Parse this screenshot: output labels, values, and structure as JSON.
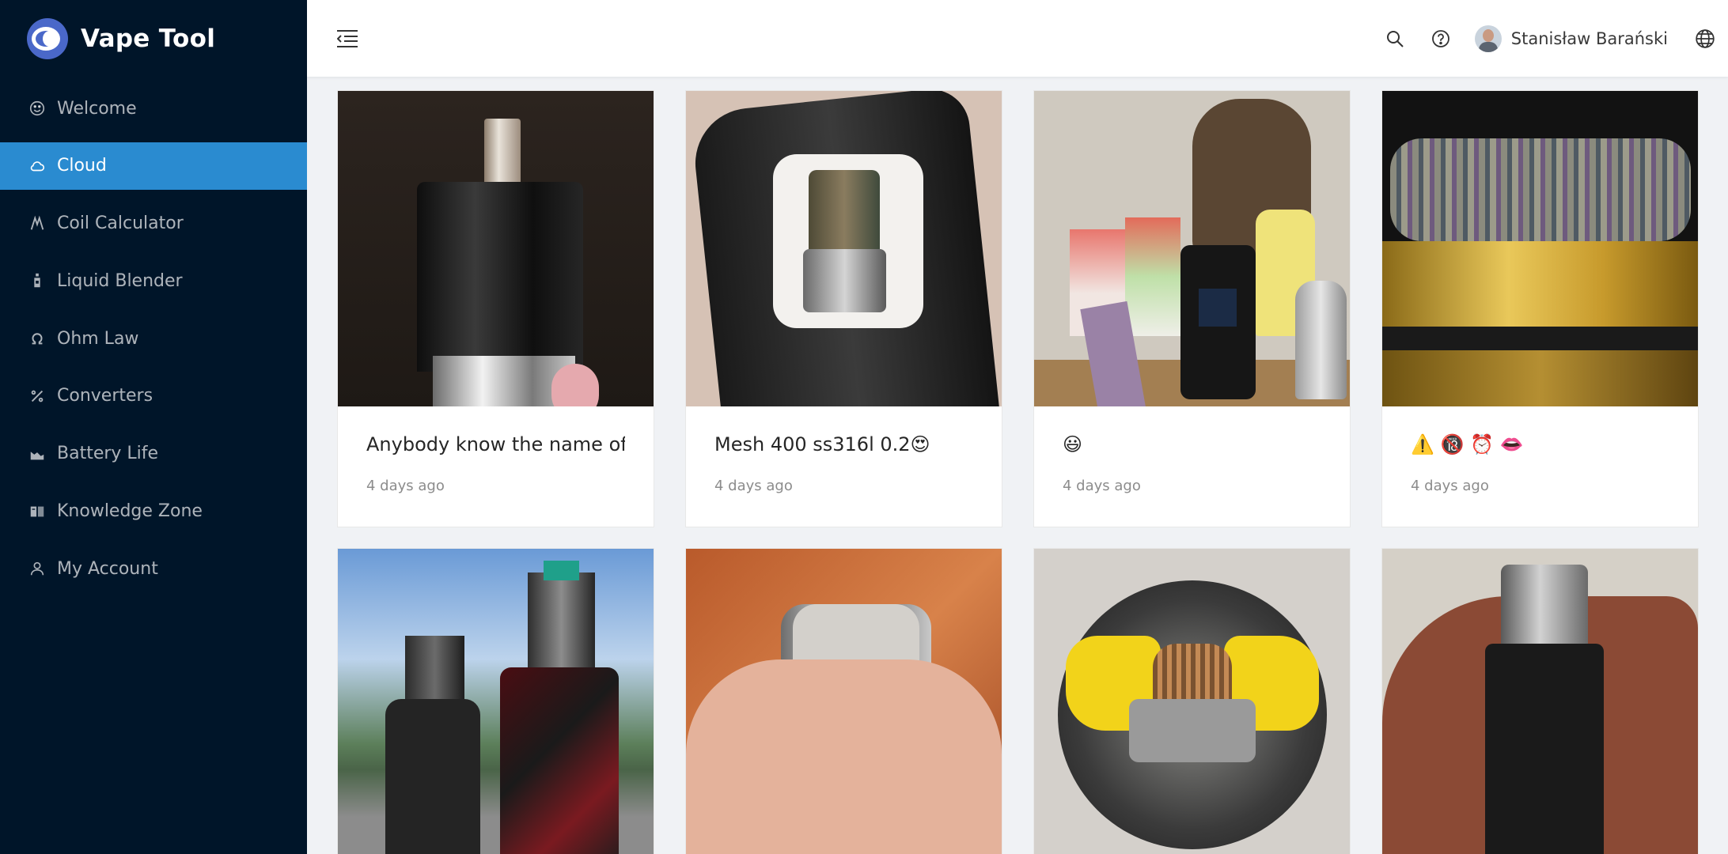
{
  "app": {
    "title": "Vape Tool",
    "accent_color": "#2a8bd0",
    "sidebar_color": "#001529"
  },
  "sidebar": {
    "items": [
      {
        "label": "Welcome",
        "icon": "smile-icon",
        "active": false
      },
      {
        "label": "Cloud",
        "icon": "cloud-icon",
        "active": true
      },
      {
        "label": "Coil Calculator",
        "icon": "coil-icon",
        "active": false
      },
      {
        "label": "Liquid Blender",
        "icon": "bottle-icon",
        "active": false
      },
      {
        "label": "Ohm Law",
        "icon": "omega-icon",
        "active": false
      },
      {
        "label": "Converters",
        "icon": "percent-icon",
        "active": false
      },
      {
        "label": "Battery Life",
        "icon": "chart-icon",
        "active": false
      },
      {
        "label": "Knowledge Zone",
        "icon": "book-icon",
        "active": false
      },
      {
        "label": "My Account",
        "icon": "user-icon",
        "active": false
      }
    ]
  },
  "header": {
    "user_name": "Stanisław Barański",
    "icons": [
      "menu-fold-icon",
      "search-icon",
      "question-circle-icon",
      "globe-icon"
    ]
  },
  "cards": [
    {
      "title": "Anybody know the name of this",
      "time": "4 days ago"
    },
    {
      "title": "Mesh 400 ss316l 0.2😍",
      "time": "4 days ago"
    },
    {
      "title": "😃",
      "time": "4 days ago"
    },
    {
      "title": "⚠️ 🔞 ⏰ 👄",
      "time": "4 days ago"
    },
    {
      "title": "",
      "time": ""
    },
    {
      "title": "",
      "time": ""
    },
    {
      "title": "",
      "time": ""
    },
    {
      "title": "",
      "time": ""
    }
  ]
}
